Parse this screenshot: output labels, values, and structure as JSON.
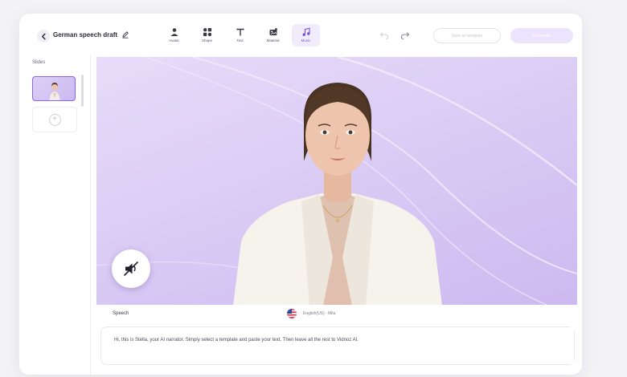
{
  "header": {
    "project_title": "German speech draft",
    "save_label": "Save as template",
    "export_label": "Generate"
  },
  "toolbar": [
    {
      "label": "Avatar",
      "icon": "avatar-icon"
    },
    {
      "label": "Shape",
      "icon": "shape-icon"
    },
    {
      "label": "Text",
      "icon": "text-icon"
    },
    {
      "label": "Material",
      "icon": "material-icon"
    },
    {
      "label": "Music",
      "icon": "music-icon",
      "active": true
    }
  ],
  "slides": {
    "heading": "Slides"
  },
  "speech": {
    "label": "Speech",
    "voice": "English(US) - Mila",
    "text": "Hi, this is Stella, your AI narrator. Simply select a template and paste your text. Then leave all the rest to Vidnoz AI."
  },
  "colors": {
    "accent": "#8d63e0",
    "canvas_bg": "#d8c9f4",
    "export_bg": "#ece3fc"
  }
}
